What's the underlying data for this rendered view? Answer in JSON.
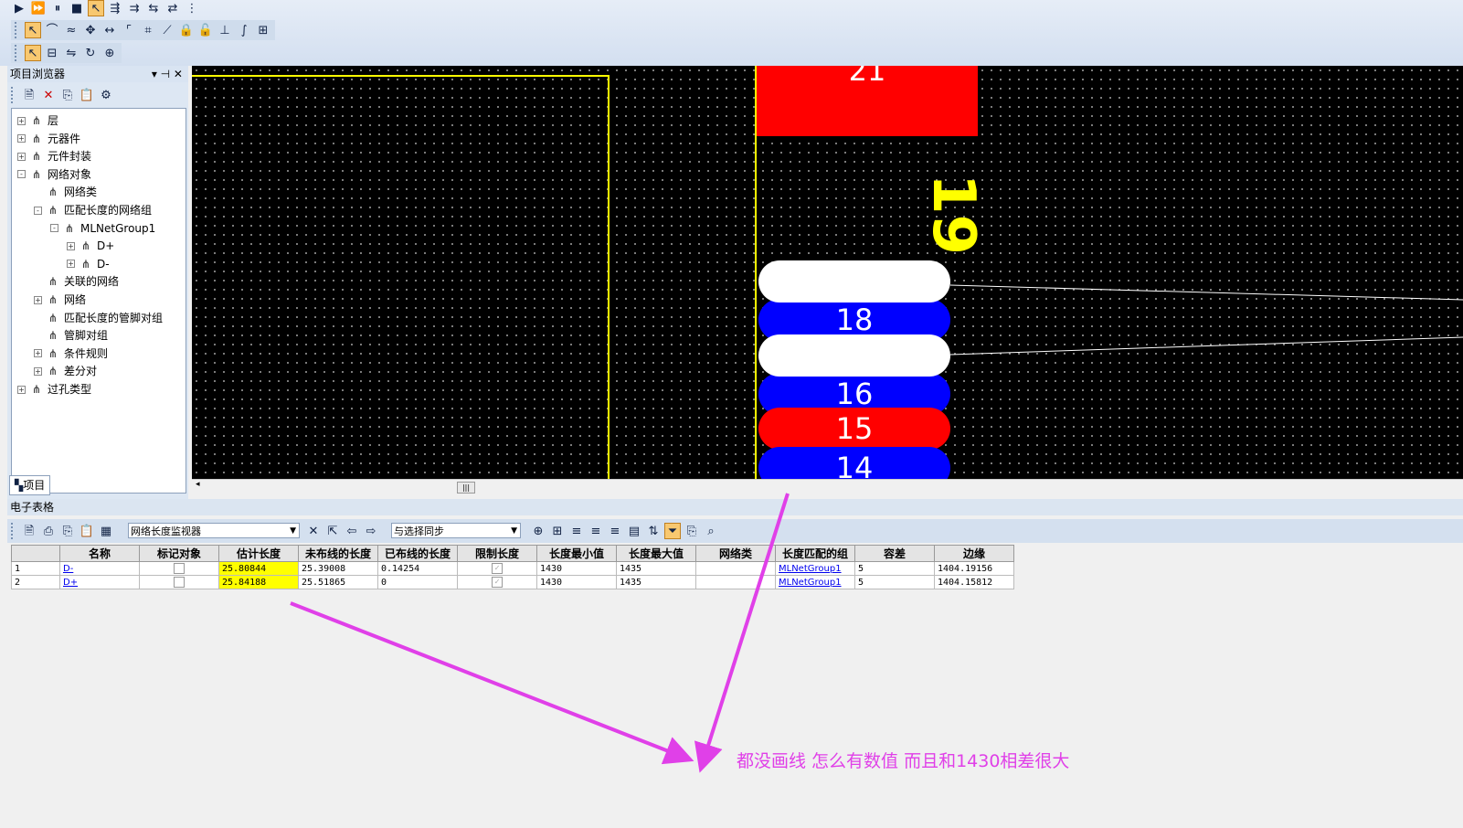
{
  "project_browser": {
    "title": "项目浏览器",
    "tab_label": "项目",
    "tree": [
      {
        "label": "层",
        "icon": "layers-icon",
        "expander": "+"
      },
      {
        "label": "元器件",
        "icon": "component-icon",
        "expander": "+"
      },
      {
        "label": "元件封装",
        "icon": "footprint-icon",
        "expander": "+"
      },
      {
        "label": "网络对象",
        "icon": "net-object-icon",
        "expander": "-"
      },
      {
        "label": "网络类",
        "icon": "net-class-icon",
        "expander": ""
      },
      {
        "label": "匹配长度的网络组",
        "icon": "matched-net-group-icon",
        "expander": "-"
      },
      {
        "label": "MLNetGroup1",
        "icon": "net-group-icon",
        "expander": "-"
      },
      {
        "label": "D+",
        "icon": "net-icon",
        "expander": "+"
      },
      {
        "label": "D-",
        "icon": "net-icon",
        "expander": "+"
      },
      {
        "label": "关联的网络",
        "icon": "associated-net-icon",
        "expander": ""
      },
      {
        "label": "网络",
        "icon": "net-icon",
        "expander": "+"
      },
      {
        "label": "匹配长度的管脚对组",
        "icon": "pin-pair-group-icon",
        "expander": ""
      },
      {
        "label": "管脚对组",
        "icon": "pin-pair-icon",
        "expander": ""
      },
      {
        "label": "条件规则",
        "icon": "rule-icon",
        "expander": "+"
      },
      {
        "label": "差分对",
        "icon": "diff-pair-icon",
        "expander": "+"
      },
      {
        "label": "过孔类型",
        "icon": "via-icon",
        "expander": "+"
      }
    ]
  },
  "pcb": {
    "pads": [
      {
        "label": "21",
        "color": "#ff0000"
      },
      {
        "label": "18",
        "color": "#0000ff"
      },
      {
        "label": "16",
        "color": "#0000ff"
      },
      {
        "label": "15",
        "color": "#ff0000"
      },
      {
        "label": "14",
        "color": "#0000ff"
      }
    ],
    "component_label": "19",
    "outline_color": "#ffff00"
  },
  "spreadsheet": {
    "title": "电子表格",
    "view_select": "网络长度监视器",
    "sync_select": "与选择同步",
    "columns": [
      "名称",
      "标记对象",
      "估计长度",
      "未布线的长度",
      "已布线的长度",
      "限制长度",
      "长度最小值",
      "长度最大值",
      "网络类",
      "长度匹配的组",
      "容差",
      "边缘"
    ],
    "rows": [
      {
        "num": "1",
        "name": "D-",
        "est": "25.80844",
        "unrouted": "25.39008",
        "routed": "0.14254",
        "min": "1430",
        "max": "1435",
        "netclass": "",
        "group": "MLNetGroup1",
        "tol": "5",
        "margin": "1404.19156"
      },
      {
        "num": "2",
        "name": "D+",
        "est": "25.84188",
        "unrouted": "25.51865",
        "routed": "0",
        "min": "1430",
        "max": "1435",
        "netclass": "",
        "group": "MLNetGroup1",
        "tol": "5",
        "margin": "1404.15812"
      }
    ]
  },
  "annotation": {
    "text": "都没画线  怎么有数值  而且和1430相差很大",
    "color": "#e040e8"
  }
}
